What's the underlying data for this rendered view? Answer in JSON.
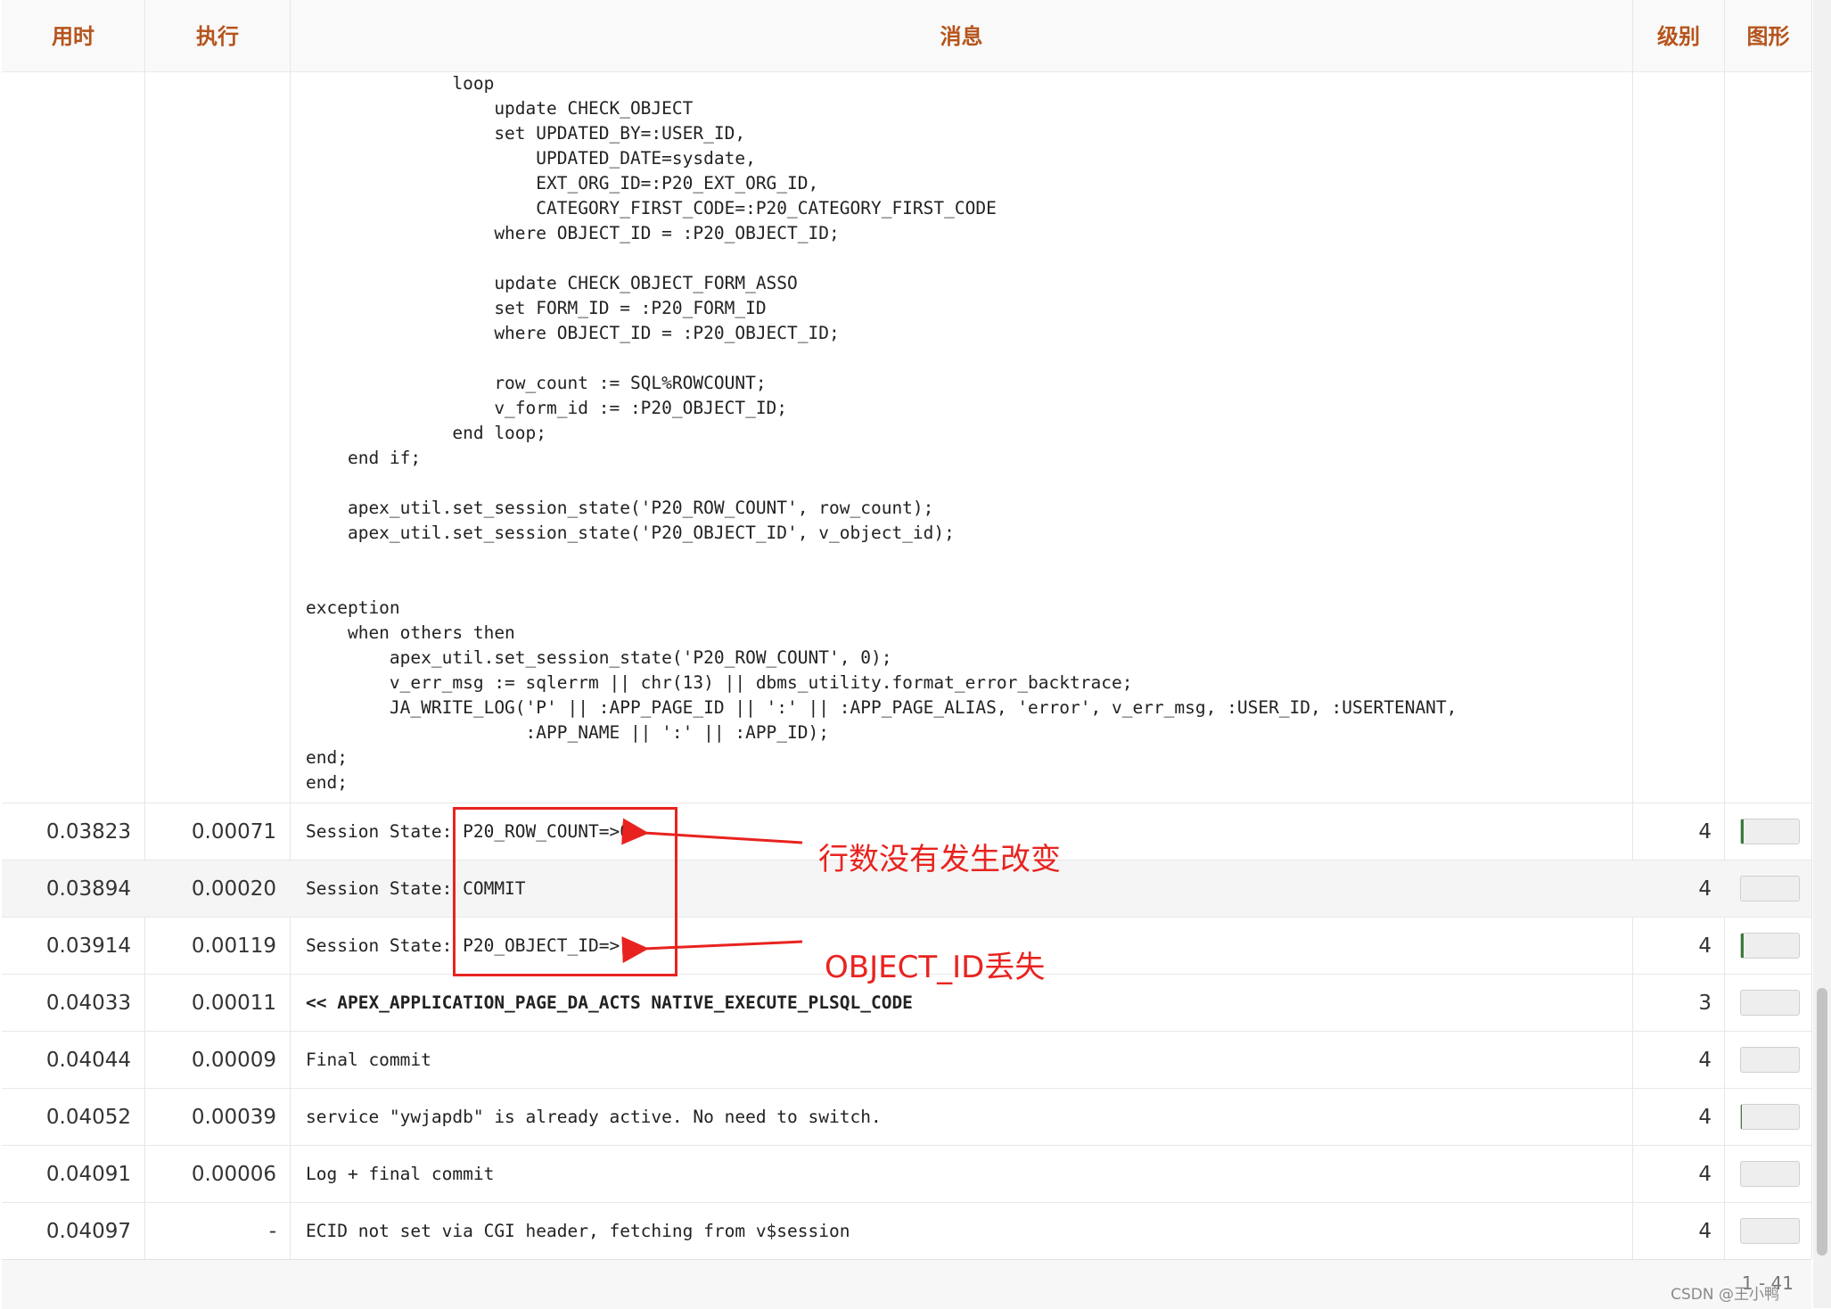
{
  "headers": {
    "time": "用时",
    "exec": "执行",
    "message": "消息",
    "level": "级别",
    "graph": "图形"
  },
  "code_lines": [
    "              loop",
    "                  update CHECK_OBJECT",
    "                  set UPDATED_BY=:USER_ID,",
    "                      UPDATED_DATE=sysdate,",
    "                      EXT_ORG_ID=:P20_EXT_ORG_ID,",
    "                      CATEGORY_FIRST_CODE=:P20_CATEGORY_FIRST_CODE",
    "                  where OBJECT_ID = :P20_OBJECT_ID;",
    "",
    "                  update CHECK_OBJECT_FORM_ASSO",
    "                  set FORM_ID = :P20_FORM_ID",
    "                  where OBJECT_ID = :P20_OBJECT_ID;",
    "",
    "                  row_count := SQL%ROWCOUNT;",
    "                  v_form_id := :P20_OBJECT_ID;",
    "              end loop;",
    "    end if;",
    "",
    "    apex_util.set_session_state('P20_ROW_COUNT', row_count);",
    "    apex_util.set_session_state('P20_OBJECT_ID', v_object_id);",
    "",
    "",
    "exception",
    "    when others then",
    "        apex_util.set_session_state('P20_ROW_COUNT', 0);",
    "        v_err_msg := sqlerrm || chr(13) || dbms_utility.format_error_backtrace;",
    "        JA_WRITE_LOG('P' || :APP_PAGE_ID || ':' || :APP_PAGE_ALIAS, 'error', v_err_msg, :USER_ID, :USERTENANT,",
    "                     :APP_NAME || ':' || :APP_ID);",
    "end;",
    "end;"
  ],
  "rows": [
    {
      "time": "0.03823",
      "exec": "0.00071",
      "message": "Session State: P20_ROW_COUNT=>0",
      "level": "4",
      "bar_fraction": 0.04
    },
    {
      "time": "0.03894",
      "exec": "0.00020",
      "message": "Session State: COMMIT",
      "level": "4",
      "bar_fraction": 0.0
    },
    {
      "time": "0.03914",
      "exec": "0.00119",
      "message": "Session State: P20_OBJECT_ID=>",
      "level": "4",
      "bar_fraction": 0.04
    },
    {
      "time": "0.04033",
      "exec": "0.00011",
      "message": "<< APEX_APPLICATION_PAGE_DA_ACTS NATIVE_EXECUTE_PLSQL_CODE",
      "level": "3",
      "bar_fraction": 0.0,
      "bold": true
    },
    {
      "time": "0.04044",
      "exec": "0.00009",
      "message": "Final commit",
      "level": "4",
      "bar_fraction": 0.0
    },
    {
      "time": "0.04052",
      "exec": "0.00039",
      "message": "service \"ywjapdb\" is already active. No need to switch.",
      "level": "4",
      "bar_fraction": 0.02
    },
    {
      "time": "0.04091",
      "exec": "0.00006",
      "message": "Log + final commit",
      "level": "4",
      "bar_fraction": 0.0
    },
    {
      "time": "0.04097",
      "exec": "-",
      "message": "ECID not set via CGI header, fetching from v$session",
      "level": "4",
      "bar_fraction": 0.0
    }
  ],
  "annotations": {
    "row_count_note": "行数没有发生改变",
    "object_id_note": "OBJECT_ID丢失",
    "color": "#e8231f"
  },
  "footer": {
    "pager": "1 - 41",
    "watermark": "CSDN @王小鸭"
  },
  "colors": {
    "header_text": "#b5541c",
    "bar_fill": "#3c7a3c"
  }
}
